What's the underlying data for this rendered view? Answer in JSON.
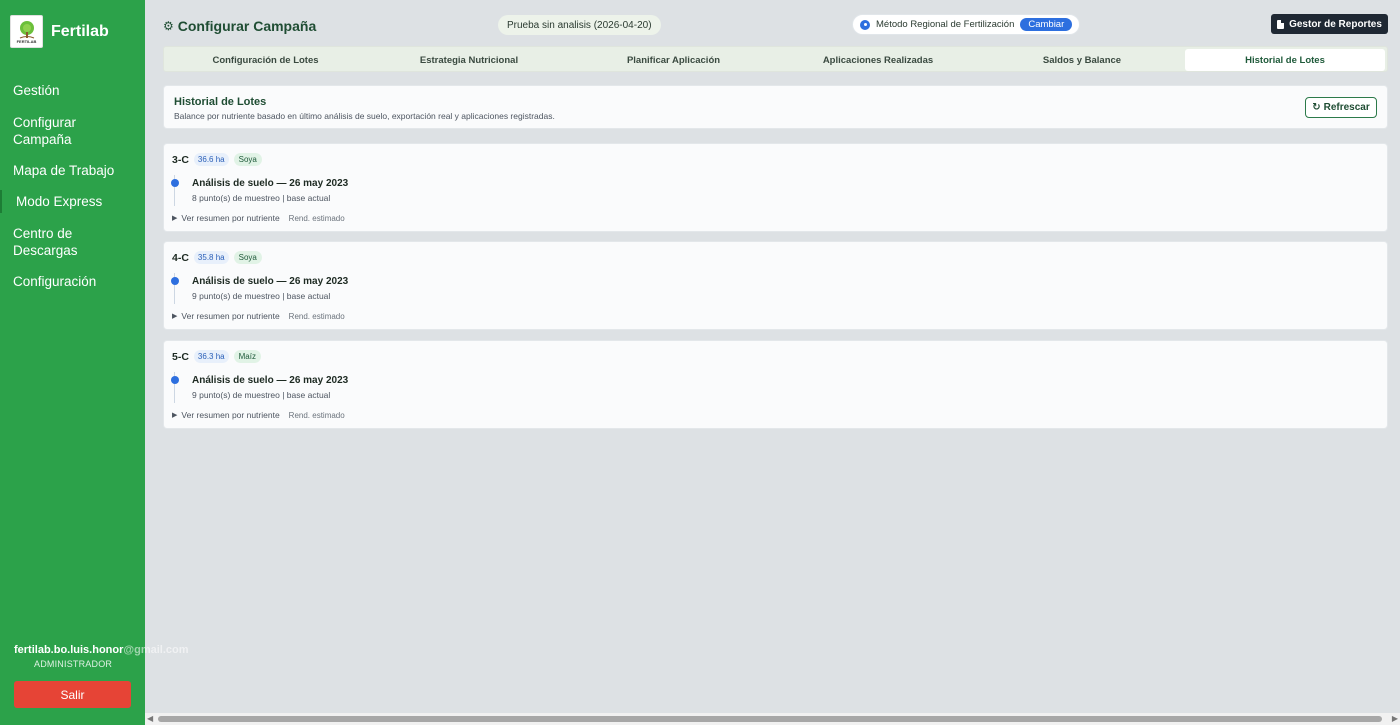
{
  "sidebar": {
    "brand": "Fertilab",
    "logo_text": "FERTILAB",
    "nav": [
      "Gestión",
      "Configurar Campaña",
      "Mapa de Trabajo",
      "Modo Express",
      "Centro de Descargas",
      "Configuración"
    ],
    "user": {
      "email_visible": "fertilab.bo.luis.honor",
      "email_faded": "@gmail.com",
      "role": "ADMINISTRADOR"
    },
    "logout_label": "Salir",
    "color": "#2ca24a"
  },
  "header": {
    "title": "Configurar Campaña",
    "title_icon": "gear-icon",
    "trial": "Prueba sin analisis (2026-04-20)",
    "method_label": "Método Regional de Fertilización",
    "method_change": "Cambiar",
    "reports_label": "Gestor de Reportes"
  },
  "tabs": [
    {
      "label": "Configuración de Lotes"
    },
    {
      "label": "Estrategia Nutricional"
    },
    {
      "label": "Planificar Aplicación"
    },
    {
      "label": "Aplicaciones Realizadas"
    },
    {
      "label": "Saldos y Balance"
    },
    {
      "label": "Historial de Lotes"
    }
  ],
  "section": {
    "title": "Historial de Lotes",
    "subtitle": "Balance por nutriente basado en último análisis de suelo, exportación real y aplicaciones registradas.",
    "refresh_label": "Refrescar"
  },
  "lots": [
    {
      "name": "3-C",
      "area": "36.6 ha",
      "crop": "Soya",
      "event_title": "Análisis de suelo — 26 may 2023",
      "event_sub": "8 punto(s) de muestreo | base actual",
      "details": "Ver resumen por nutriente",
      "rend": "Rend. estimado"
    },
    {
      "name": "4-C",
      "area": "35.8 ha",
      "crop": "Soya",
      "event_title": "Análisis de suelo — 26 may 2023",
      "event_sub": "9 punto(s) de muestreo | base actual",
      "details": "Ver resumen por nutriente",
      "rend": "Rend. estimado"
    },
    {
      "name": "5-C",
      "area": "36.3 ha",
      "crop": "Maíz",
      "event_title": "Análisis de suelo — 26 may 2023",
      "event_sub": "9 punto(s) de muestreo | base actual",
      "details": "Ver resumen por nutriente",
      "rend": "Rend. estimado"
    }
  ]
}
